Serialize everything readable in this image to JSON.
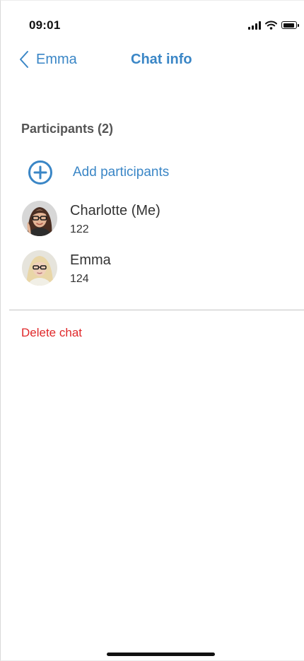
{
  "status_bar": {
    "time": "09:01",
    "icons": [
      "cellular-signal-icon",
      "wifi-icon",
      "battery-icon"
    ]
  },
  "nav": {
    "back_label": "Emma",
    "back_icon": "chevron-left-icon",
    "title": "Chat info"
  },
  "participants_section": {
    "title": "Participants (2)",
    "add_label": "Add participants",
    "add_icon": "plus-circle-icon",
    "items": [
      {
        "name": "Charlotte (Me)",
        "number": "122",
        "avatar": "avatar-charlotte"
      },
      {
        "name": "Emma",
        "number": "124",
        "avatar": "avatar-emma"
      }
    ]
  },
  "actions": {
    "delete_label": "Delete chat"
  },
  "colors": {
    "accent": "#3a86c6",
    "danger": "#e0282a",
    "text": "#333333",
    "section_title": "#555555",
    "divider": "#c4c4c4"
  }
}
